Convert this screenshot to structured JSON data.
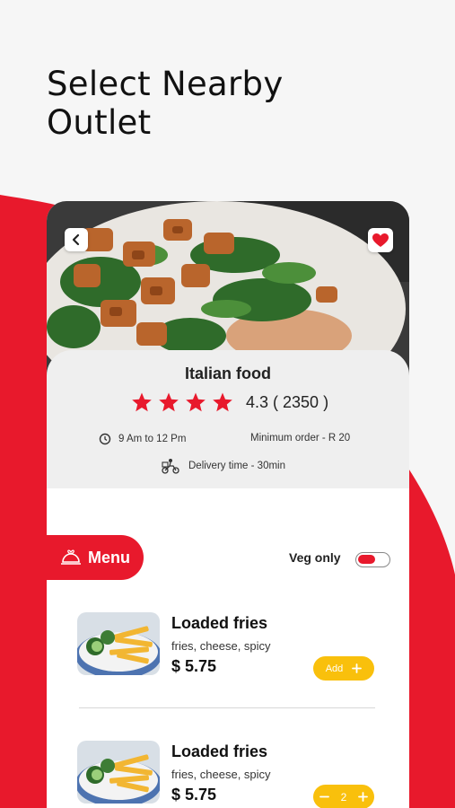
{
  "headline": {
    "line1": "Select Nearby",
    "line2": "Outlet"
  },
  "colors": {
    "accent": "#e8192c",
    "add_button": "#f9c00c",
    "card_bg": "#efefef"
  },
  "restaurant": {
    "name": "Italian food",
    "stars": 4,
    "rating_text": "4.3 ( 2350 )",
    "hours": "9 Am to 12 Pm",
    "minimum_order": "Minimum order - R 20",
    "delivery_time": "Delivery time - 30min"
  },
  "menu": {
    "tab_label": "Menu",
    "veg_only_label": "Veg only",
    "veg_only_on": true
  },
  "items": [
    {
      "name": "Loaded fries",
      "description": "fries, cheese, spicy",
      "price": "$ 5.75",
      "add_label": "Add"
    },
    {
      "name": "Loaded fries",
      "description": "fries, cheese, spicy",
      "price": "$ 5.75",
      "quantity": "2"
    }
  ],
  "icons": {
    "back": "chevron-left-icon",
    "favorite": "heart-icon",
    "clock": "clock-icon",
    "delivery": "delivery-rider-icon",
    "menu": "cloche-icon"
  }
}
